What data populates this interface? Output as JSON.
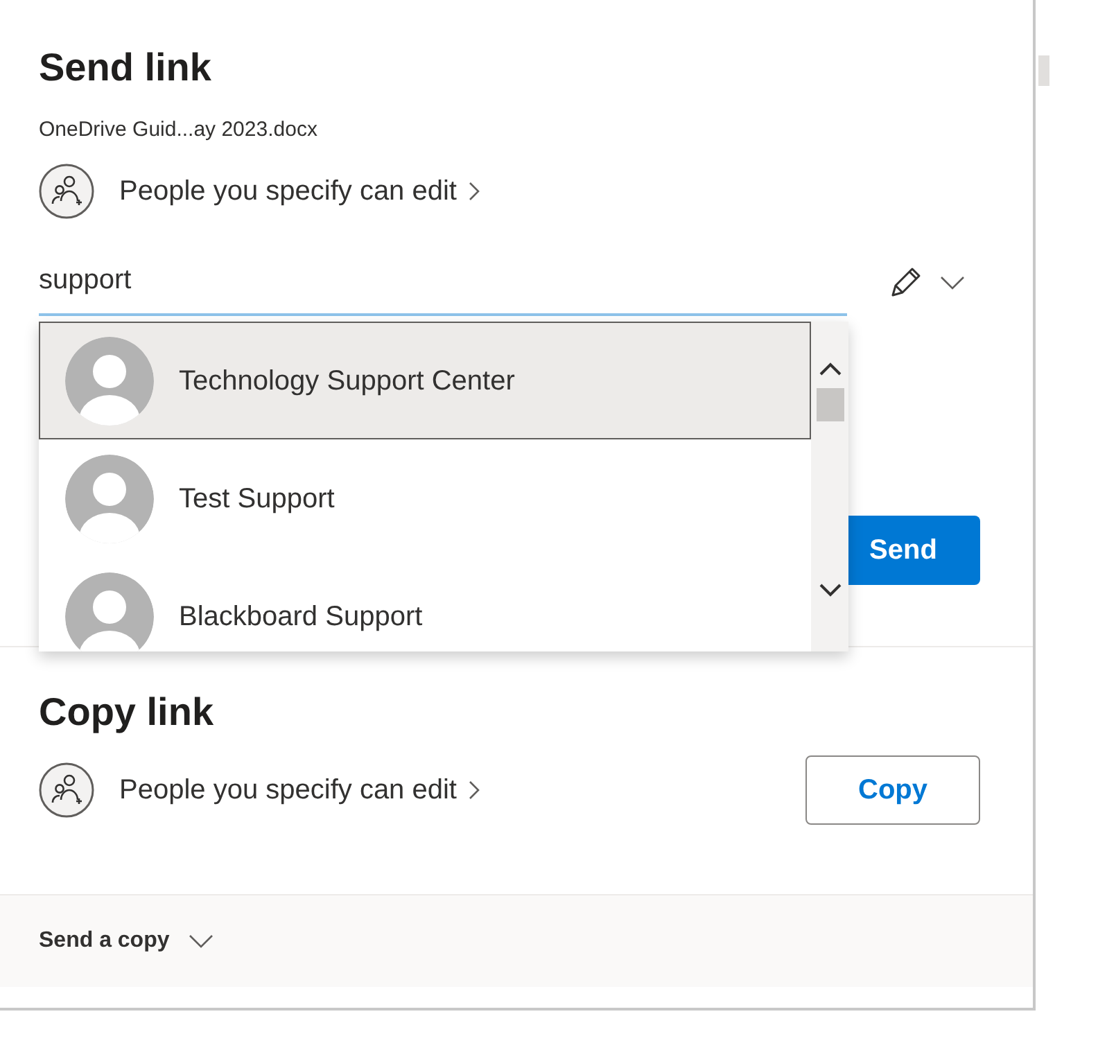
{
  "send_link": {
    "title": "Send link",
    "file_name": "OneDrive Guid...ay 2023.docx",
    "permission": "People you specify can edit",
    "recipient_field": {
      "value": "support"
    },
    "send_button": "Send"
  },
  "suggestions": [
    {
      "name": "Technology Support Center",
      "selected": true
    },
    {
      "name": "Test Support",
      "selected": false
    },
    {
      "name": "Blackboard Support",
      "selected": false
    }
  ],
  "copy_link": {
    "title": "Copy link",
    "permission": "People you specify can edit",
    "copy_button": "Copy"
  },
  "footer": {
    "label": "Send a copy"
  }
}
